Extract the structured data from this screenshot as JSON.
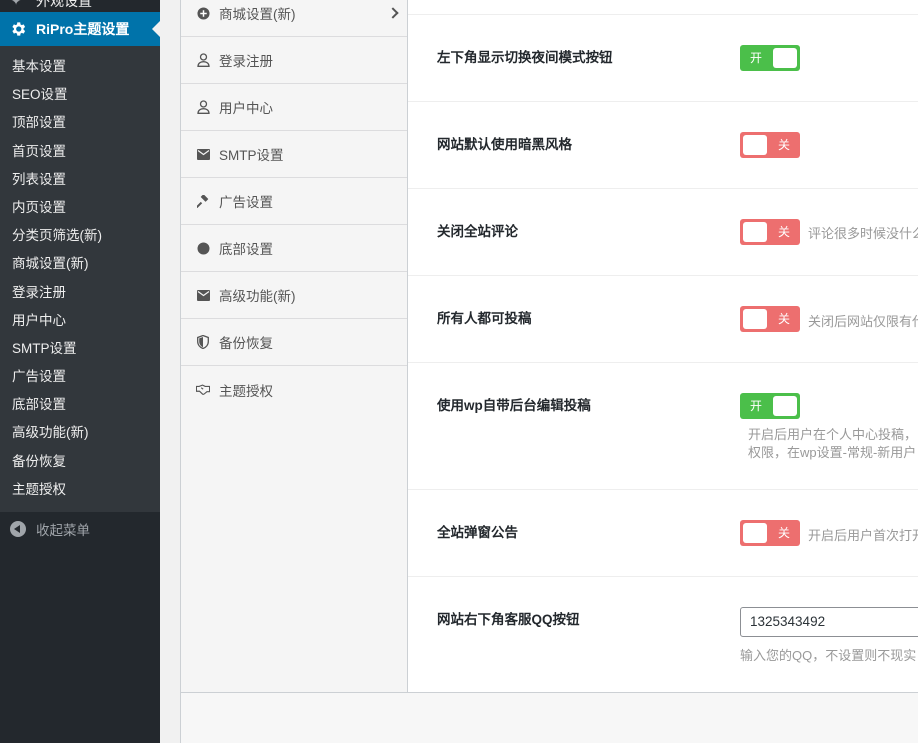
{
  "admin_menu": {
    "top_cut_label": "外观设置",
    "current": {
      "label": "RiPro主题设置",
      "icon": "gear-icon"
    },
    "subitems": [
      "基本设置",
      "SEO设置",
      "顶部设置",
      "首页设置",
      "列表设置",
      "内页设置",
      "分类页筛选(新)",
      "商城设置(新)",
      "登录注册",
      "用户中心",
      "SMTP设置",
      "广告设置",
      "底部设置",
      "高级功能(新)",
      "备份恢复",
      "主题授权"
    ],
    "collapse_label": "收起菜单"
  },
  "settings_nav": {
    "items": [
      {
        "label": "商城设置(新)",
        "icon": "plus-circle-icon"
      },
      {
        "label": "登录注册",
        "icon": "user-icon"
      },
      {
        "label": "用户中心",
        "icon": "user-icon"
      },
      {
        "label": "SMTP设置",
        "icon": "envelope-icon"
      },
      {
        "label": "广告设置",
        "icon": "hammer-icon"
      },
      {
        "label": "底部设置",
        "icon": "circle-icon"
      },
      {
        "label": "高级功能(新)",
        "icon": "envelope-icon"
      },
      {
        "label": "备份恢复",
        "icon": "shield-icon"
      },
      {
        "label": "主题授权",
        "icon": "handshake-icon"
      }
    ]
  },
  "fields": [
    {
      "title": "左下角显示切换夜间模式按钮",
      "switch_on": true,
      "switch_label": "开",
      "desc": ""
    },
    {
      "title": "网站默认使用暗黑风格",
      "switch_on": false,
      "switch_label": "关",
      "desc": ""
    },
    {
      "title": "关闭全站评论",
      "switch_on": false,
      "switch_label": "关",
      "desc": "评论很多时候没什么"
    },
    {
      "title": "所有人都可投稿",
      "switch_on": false,
      "switch_label": "关",
      "desc": "关闭后网站仅限有代"
    },
    {
      "title": "使用wp自带后台编辑投稿",
      "switch_on": true,
      "switch_label": "开",
      "desc_line1": "开启后用户在个人中心投稿，",
      "desc_line2": "权限，在wp设置-常规-新用户"
    },
    {
      "title": "全站弹窗公告",
      "switch_on": false,
      "switch_label": "关",
      "desc": "开启后用户首次打开"
    },
    {
      "title": "网站右下角客服QQ按钮",
      "input_value": "1325343492",
      "desc": "输入您的QQ，不设置则不现实"
    }
  ],
  "colors": {
    "sidebar_bg": "#23282d",
    "submenu_bg": "#32373c",
    "accent": "#0073aa",
    "switch_on": "#4bbf4a",
    "switch_off": "#ed6f6f"
  }
}
